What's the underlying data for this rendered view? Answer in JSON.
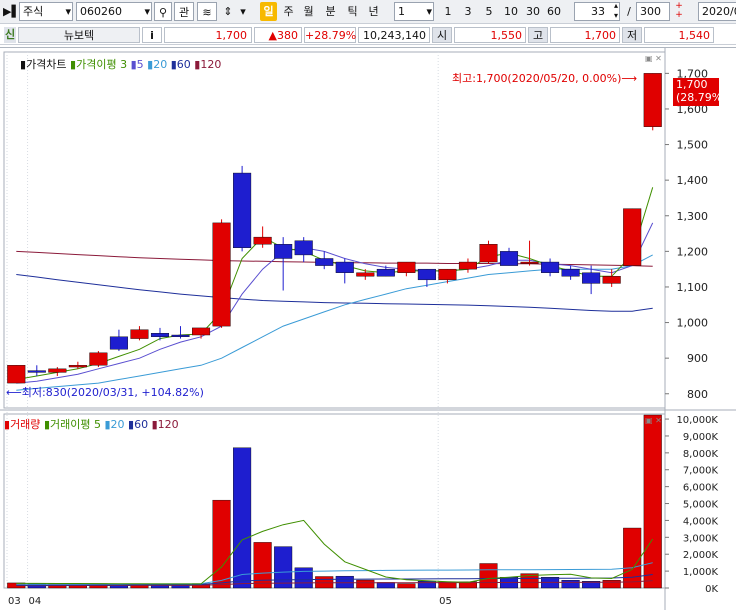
{
  "toolbar": {
    "market_type": "주식",
    "code": "060260",
    "btn_gwan": "관",
    "period_options": [
      "일",
      "주",
      "월",
      "분",
      "틱",
      "년"
    ],
    "active_period": "일",
    "interval_value": "1",
    "interval_options": [
      "1",
      "3",
      "5",
      "10",
      "30",
      "60"
    ],
    "zoom_value": "33",
    "total_value": "300",
    "slash": "/",
    "date_value": "2020/0"
  },
  "info": {
    "market_flag": "신",
    "stock_name": "뉴보텍",
    "info_button": "i",
    "price": "1,700",
    "change": "▲380",
    "change_pct": "+28.79%",
    "volume": "10,243,140",
    "open_label": "시",
    "open": "1,550",
    "high_label": "고",
    "high": "1,700",
    "low_label": "저",
    "low": "1,540"
  },
  "price_panel": {
    "legend_title": "가격차트",
    "legend_ma_title": "가격이평",
    "legend_ma_periods": [
      "3",
      "5",
      "20",
      "60",
      "120"
    ],
    "max_annotation": "최고:1,700(2020/05/20, 0.00%)",
    "min_annotation": "최저:830(2020/03/31, +104.82%)",
    "last_price_badge": "1,700",
    "last_pct_badge": "(28.79%)"
  },
  "volume_panel": {
    "legend_title": "거래량",
    "legend_ma_title": "거래이평",
    "legend_ma_periods": [
      "5",
      "20",
      "60",
      "120"
    ]
  },
  "x_axis": {
    "labels": [
      "03",
      "04",
      "05"
    ]
  },
  "colors": {
    "up": "#e00000",
    "down": "#1e1ecf",
    "ma3": "#3f8f00",
    "ma5": "#5a4fd0",
    "ma20": "#3a9bd6",
    "ma60": "#1e2f9a",
    "ma120": "#8b1a3a"
  },
  "chart_data": [
    {
      "type": "candlestick",
      "title": "가격차트",
      "ylim": [
        760,
        1760
      ],
      "yticks": [
        "800",
        "900",
        "1,000",
        "1,100",
        "1,200",
        "1,300",
        "1,400",
        "1,500",
        "1,600",
        "1,700"
      ],
      "ohlc": [
        [
          830,
          880,
          830,
          880
        ],
        [
          865,
          880,
          850,
          860
        ],
        [
          860,
          875,
          850,
          870
        ],
        [
          875,
          890,
          870,
          880
        ],
        [
          880,
          920,
          875,
          915
        ],
        [
          960,
          980,
          920,
          925
        ],
        [
          955,
          990,
          950,
          980
        ],
        [
          970,
          985,
          950,
          960
        ],
        [
          965,
          990,
          955,
          960
        ],
        [
          965,
          985,
          955,
          985
        ],
        [
          990,
          1290,
          985,
          1280
        ],
        [
          1420,
          1440,
          1200,
          1210
        ],
        [
          1220,
          1270,
          1210,
          1240
        ],
        [
          1220,
          1240,
          1090,
          1180
        ],
        [
          1230,
          1240,
          1170,
          1190
        ],
        [
          1180,
          1200,
          1150,
          1160
        ],
        [
          1170,
          1180,
          1110,
          1140
        ],
        [
          1130,
          1150,
          1120,
          1140
        ],
        [
          1150,
          1160,
          1130,
          1130
        ],
        [
          1140,
          1170,
          1130,
          1170
        ],
        [
          1150,
          1150,
          1100,
          1120
        ],
        [
          1120,
          1150,
          1110,
          1150
        ],
        [
          1150,
          1180,
          1140,
          1170
        ],
        [
          1170,
          1230,
          1165,
          1220
        ],
        [
          1200,
          1210,
          1160,
          1160
        ],
        [
          1170,
          1230,
          1160,
          1170
        ],
        [
          1170,
          1180,
          1130,
          1140
        ],
        [
          1150,
          1160,
          1120,
          1130
        ],
        [
          1140,
          1160,
          1080,
          1110
        ],
        [
          1110,
          1150,
          1100,
          1130
        ],
        [
          1160,
          1320,
          1160,
          1320
        ],
        [
          1550,
          1700,
          1540,
          1700
        ]
      ],
      "ma3": [
        840,
        850,
        860,
        870,
        885,
        905,
        925,
        955,
        965,
        968,
        1030,
        1180,
        1240,
        1210,
        1200,
        1175,
        1160,
        1145,
        1140,
        1145,
        1145,
        1145,
        1150,
        1185,
        1195,
        1180,
        1160,
        1145,
        1130,
        1130,
        1190,
        1380
      ],
      "ma5": [
        830,
        835,
        845,
        855,
        870,
        885,
        900,
        925,
        945,
        960,
        990,
        1080,
        1150,
        1200,
        1210,
        1200,
        1180,
        1165,
        1155,
        1150,
        1145,
        1145,
        1150,
        1160,
        1175,
        1175,
        1165,
        1160,
        1150,
        1140,
        1160,
        1280
      ],
      "ma20": [
        810,
        815,
        820,
        825,
        830,
        840,
        850,
        860,
        870,
        880,
        900,
        930,
        960,
        990,
        1010,
        1030,
        1050,
        1065,
        1080,
        1095,
        1105,
        1115,
        1125,
        1135,
        1140,
        1145,
        1150,
        1150,
        1150,
        1150,
        1160,
        1190
      ],
      "ma60": [
        1135,
        1128,
        1120,
        1113,
        1106,
        1099,
        1092,
        1086,
        1080,
        1075,
        1070,
        1066,
        1062,
        1060,
        1058,
        1056,
        1055,
        1054,
        1053,
        1052,
        1051,
        1050,
        1049,
        1047,
        1045,
        1043,
        1040,
        1037,
        1034,
        1032,
        1032,
        1040
      ],
      "ma120": [
        1200,
        1197,
        1194,
        1191,
        1188,
        1185,
        1182,
        1180,
        1178,
        1176,
        1174,
        1173,
        1172,
        1171,
        1170,
        1169,
        1168,
        1168,
        1167,
        1167,
        1167,
        1166,
        1166,
        1166,
        1165,
        1165,
        1164,
        1163,
        1162,
        1161,
        1160,
        1158
      ]
    },
    {
      "type": "bar",
      "title": "거래량",
      "ylim": [
        0,
        10300
      ],
      "yticks": [
        "0K",
        "1,000K",
        "2,000K",
        "3,000K",
        "4,000K",
        "5,000K",
        "6,000K",
        "7,000K",
        "8,000K",
        "9,000K",
        "10,000K"
      ],
      "volumes": [
        300,
        280,
        260,
        240,
        260,
        240,
        230,
        220,
        230,
        260,
        5200,
        8300,
        2700,
        2450,
        1200,
        680,
        700,
        470,
        330,
        250,
        400,
        360,
        370,
        1450,
        640,
        850,
        640,
        460,
        400,
        460,
        3550,
        10240
      ],
      "up": [
        true,
        false,
        true,
        true,
        true,
        false,
        true,
        false,
        false,
        true,
        true,
        false,
        true,
        false,
        false,
        true,
        false,
        true,
        false,
        true,
        false,
        true,
        true,
        true,
        false,
        true,
        false,
        false,
        false,
        true,
        true,
        true
      ],
      "vma5": [
        270,
        270,
        268,
        266,
        262,
        255,
        250,
        245,
        240,
        240,
        1250,
        2850,
        3350,
        3750,
        4000,
        2600,
        1550,
        1100,
        650,
        490,
        430,
        370,
        340,
        560,
        640,
        740,
        790,
        810,
        600,
        560,
        1100,
        2900
      ],
      "vma20": [
        220,
        222,
        224,
        226,
        230,
        232,
        236,
        240,
        244,
        250,
        450,
        800,
        880,
        940,
        980,
        1000,
        1020,
        1030,
        1040,
        1050,
        1060,
        1060,
        1065,
        1075,
        1080,
        1085,
        1090,
        1095,
        1100,
        1110,
        1200,
        1500
      ],
      "vma60": [
        160,
        165,
        170,
        175,
        180,
        185,
        190,
        195,
        200,
        210,
        300,
        420,
        460,
        480,
        500,
        510,
        520,
        525,
        530,
        535,
        540,
        545,
        550,
        560,
        565,
        570,
        575,
        580,
        585,
        590,
        640,
        800
      ],
      "vma120": [
        140,
        142,
        144,
        146,
        148,
        150,
        152,
        154,
        156,
        158,
        200,
        260,
        280,
        290,
        300,
        305,
        310,
        312,
        314,
        316,
        318,
        320,
        322,
        326,
        328,
        330,
        332,
        334,
        336,
        338,
        360,
        440
      ]
    }
  ]
}
